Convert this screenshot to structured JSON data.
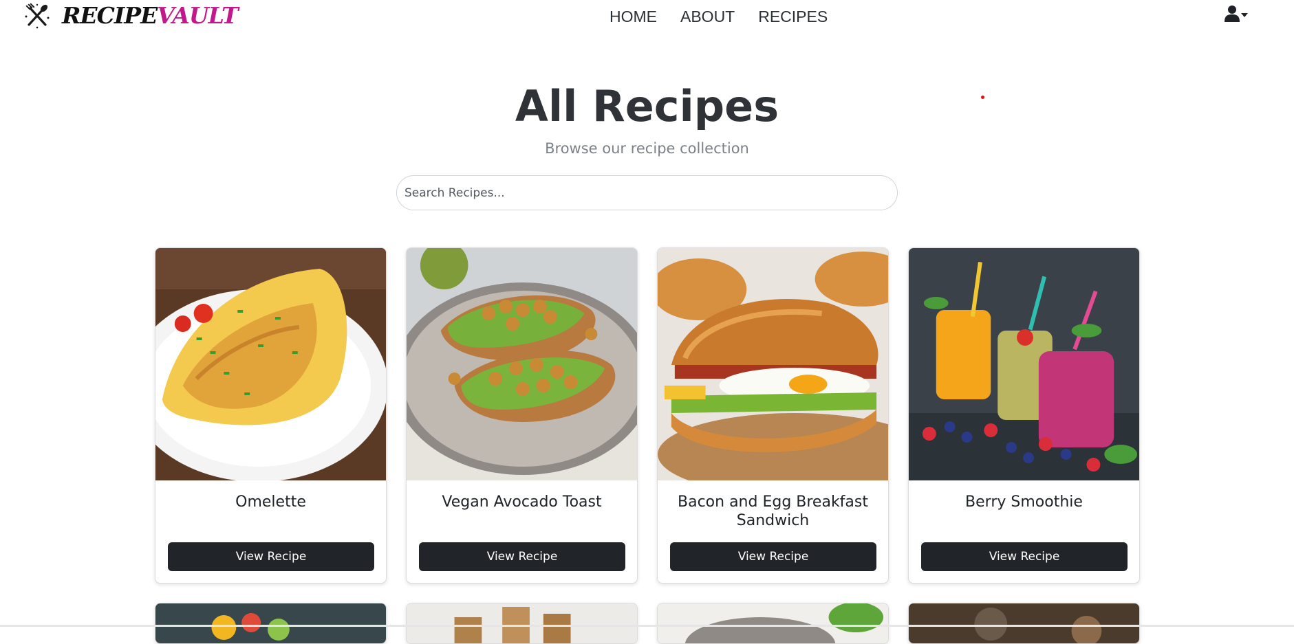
{
  "brand": {
    "part1": "RECIPE",
    "part2": "VAULT",
    "part2_color": "#c2188c"
  },
  "nav": {
    "links": [
      {
        "label": "HOME"
      },
      {
        "label": "ABOUT"
      },
      {
        "label": "RECIPES"
      }
    ],
    "user_icon": "user-icon"
  },
  "page": {
    "title": "All Recipes",
    "subtitle": "Browse our recipe collection"
  },
  "search": {
    "placeholder": "Search Recipes...",
    "value": ""
  },
  "recipes": [
    {
      "title": "Omelette",
      "button": "View Recipe"
    },
    {
      "title": "Vegan Avocado Toast",
      "button": "View Recipe"
    },
    {
      "title": "Bacon and Egg Breakfast Sandwich",
      "button": "View Recipe"
    },
    {
      "title": "Berry Smoothie",
      "button": "View Recipe"
    }
  ],
  "colors": {
    "button_bg": "#212529",
    "title_color": "#2f3338"
  }
}
